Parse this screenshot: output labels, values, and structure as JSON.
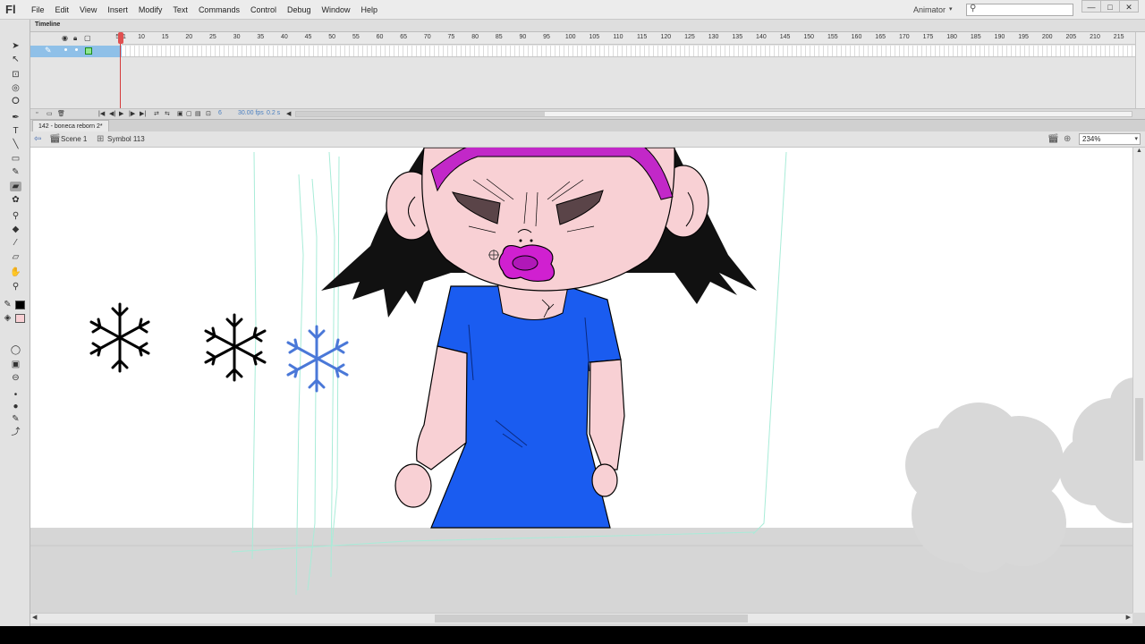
{
  "app": {
    "logo": "Fl",
    "workspace": "Animator"
  },
  "menu": [
    "File",
    "Edit",
    "View",
    "Insert",
    "Modify",
    "Text",
    "Commands",
    "Control",
    "Debug",
    "Window",
    "Help"
  ],
  "window_buttons": [
    "—",
    "□",
    "✕"
  ],
  "timeline": {
    "tab_label": "Timeline",
    "ruler": [
      "1",
      "5",
      "10",
      "15",
      "20",
      "25",
      "30",
      "35",
      "40",
      "45",
      "50",
      "55",
      "60",
      "65",
      "70",
      "75",
      "80",
      "85",
      "90",
      "95",
      "100",
      "105",
      "110",
      "115",
      "120",
      "125",
      "130",
      "135",
      "140",
      "145",
      "150",
      "155",
      "160",
      "165",
      "170",
      "175",
      "180",
      "185",
      "190",
      "195",
      "200",
      "205",
      "210",
      "215"
    ],
    "current_frame": "6",
    "fps": "30.00 fps",
    "elapsed": "0.2 s"
  },
  "document": {
    "tab": "142 - boneca reborn 2*",
    "breadcrumb": [
      "Scene 1",
      "Symbol 113"
    ],
    "zoom": "234%"
  },
  "colors": {
    "stroke": "#000000",
    "fill": "#f8d0d4",
    "dress": "#1a5cf0",
    "pacifier": "#d020d0",
    "headband": "#c228c8",
    "snowflake_blue": "#4a78d8"
  },
  "icons": {
    "tools": [
      "selection-tool-icon",
      "subselection-tool-icon",
      "free-transform-icon",
      "3d-rotation-icon",
      "lasso-icon",
      "pen-icon",
      "text-icon",
      "line-icon",
      "rectangle-icon",
      "brush-icon",
      "deco-icon",
      "bone-icon",
      "paint-bucket-icon",
      "eyedropper-icon",
      "eraser-icon",
      "hand-icon",
      "zoom-icon"
    ]
  }
}
